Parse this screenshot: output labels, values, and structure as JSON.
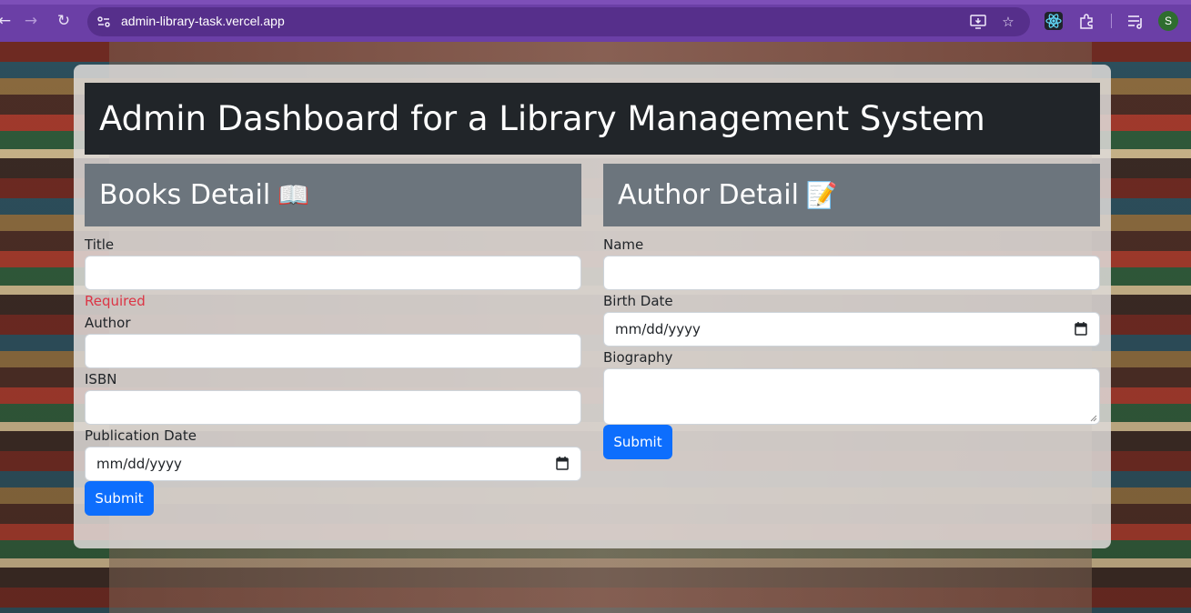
{
  "browser": {
    "url": "admin-library-task.vercel.app",
    "profile_initial": "S"
  },
  "page": {
    "title": "Admin Dashboard for a Library Management System"
  },
  "books": {
    "heading": "Books Detail",
    "heading_emoji": "📖",
    "title_label": "Title",
    "title_value": "",
    "title_error": "Required",
    "author_label": "Author",
    "author_value": "",
    "isbn_label": "ISBN",
    "isbn_value": "",
    "pubdate_label": "Publication Date",
    "pubdate_placeholder": "mm/dd/yyyy",
    "submit_label": "Submit"
  },
  "author": {
    "heading": "Author Detail",
    "heading_emoji": "📝",
    "name_label": "Name",
    "name_value": "",
    "birth_label": "Birth Date",
    "birth_placeholder": "mm/dd/yyyy",
    "bio_label": "Biography",
    "bio_value": "",
    "submit_label": "Submit"
  },
  "colors": {
    "browser_frame": "#6b3fa6",
    "title_bar": "#212529",
    "section_bar": "#6c757d",
    "primary_button": "#0d6efd",
    "error_text": "#dc3545"
  },
  "icons": [
    "back-icon",
    "forward-icon",
    "reload-icon",
    "site-settings-icon",
    "install-app-icon",
    "bookmark-star-icon",
    "react-devtools-icon",
    "extensions-icon",
    "reading-list-icon",
    "calendar-icon"
  ]
}
